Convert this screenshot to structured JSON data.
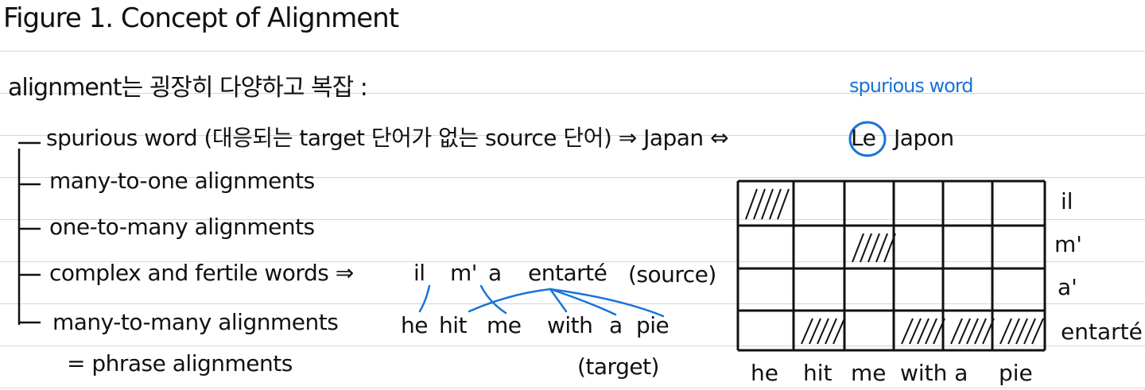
{
  "title": "Figure 1. Concept of Alignment",
  "intro": "alignment는 굉장히 다양하고 복잡 :",
  "items": [
    "spurious word (대응되는 target 단어가 없는 source 단어) ⇒ Japan ⇔",
    "many-to-one alignments",
    "one-to-many alignments",
    "complex and fertile words ⇒",
    "many-to-many alignments",
    "= phrase alignments"
  ],
  "spurious_example": {
    "highlight": "Le",
    "rest": "Japon",
    "annotation": "spurious word"
  },
  "fertile_example": {
    "source": [
      "il",
      "m'",
      "a",
      "entarté"
    ],
    "source_tag": "(source)",
    "target": [
      "he",
      "hit",
      "me",
      "with",
      "a",
      "pie"
    ],
    "target_tag": "(target)"
  },
  "matrix": {
    "rows": [
      "il",
      "m'",
      "a'",
      "entarté"
    ],
    "cols": [
      "he",
      "hit",
      "me",
      "with a",
      "pie"
    ],
    "hatched": [
      [
        0,
        0
      ],
      [
        1,
        2
      ],
      [
        3,
        1
      ],
      [
        3,
        3
      ],
      [
        3,
        4
      ],
      [
        3,
        5
      ]
    ]
  },
  "colors": {
    "ink": "#111111",
    "accent": "#1a73d9",
    "rule": "#d6d6d6"
  }
}
